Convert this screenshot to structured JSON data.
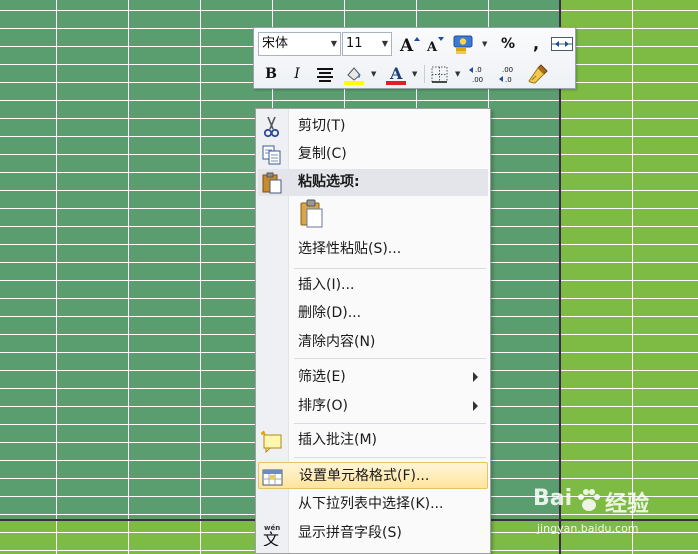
{
  "colors": {
    "grid_dark": "#5a9e6f",
    "grid_light": "#7dbb44",
    "grid_line": "#ffffff",
    "border": "#3a2d44",
    "menu_hover": "#ffe49d"
  },
  "mini_toolbar": {
    "font_name": "宋体",
    "font_size": "11",
    "row1_buttons": [
      "grow-font-icon",
      "shrink-font-icon",
      "accounting-format-icon",
      "percent-icon",
      "comma-style-icon",
      "merge-center-icon"
    ],
    "bold": "B",
    "italic": "I",
    "percent": "%",
    "comma": ",",
    "font_color_letter": "A",
    "fill_color": "#ffff00",
    "font_color": "#e02020"
  },
  "context_menu": {
    "items": [
      {
        "label": "剪切(T)",
        "icon": "scissors-icon"
      },
      {
        "label": "复制(C)",
        "icon": "copy-icon"
      },
      {
        "label": "粘贴选项:",
        "icon": "paste-options-icon"
      },
      {
        "label": "选择性粘贴(S)...",
        "icon": ""
      },
      {
        "label": "插入(I)...",
        "icon": ""
      },
      {
        "label": "删除(D)...",
        "icon": ""
      },
      {
        "label": "清除内容(N)",
        "icon": ""
      },
      {
        "label": "筛选(E)",
        "icon": ""
      },
      {
        "label": "排序(O)",
        "icon": ""
      },
      {
        "label": "插入批注(M)",
        "icon": "insert-comment-icon"
      },
      {
        "label": "设置单元格格式(F)...",
        "icon": "format-cells-icon"
      },
      {
        "label": "从下拉列表中选择(K)...",
        "icon": ""
      },
      {
        "label": "显示拼音字段(S)",
        "icon": "phonetic-icon"
      }
    ]
  },
  "watermark": {
    "brand": "Bai",
    "brand_cn": "经验",
    "url": "jingyan.baidu.com"
  }
}
